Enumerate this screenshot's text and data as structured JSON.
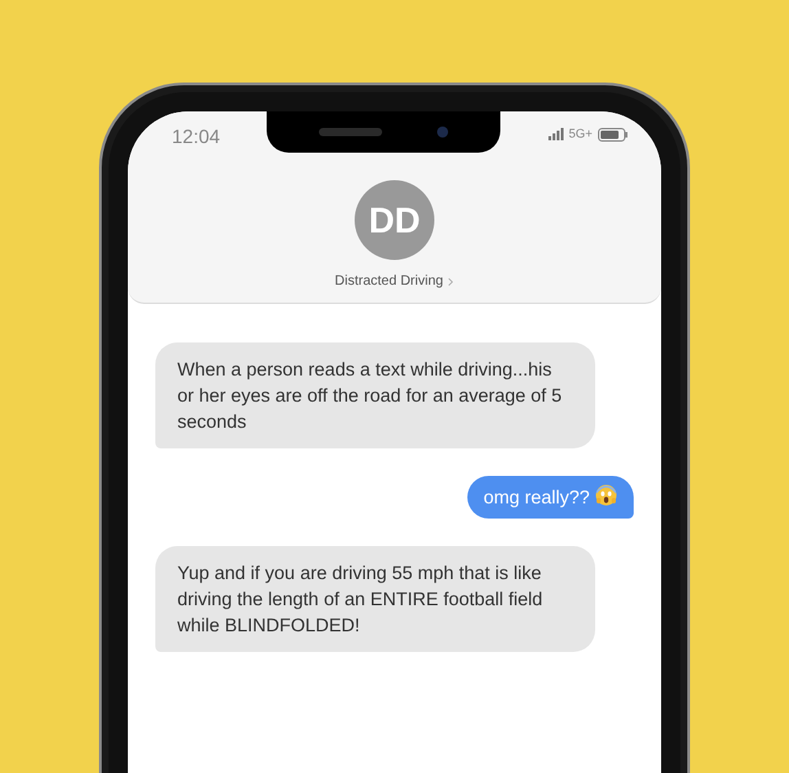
{
  "status_bar": {
    "time": "12:04",
    "network": "5G+"
  },
  "contact": {
    "initials": "DD",
    "name": "Distracted Driving"
  },
  "messages": [
    {
      "kind": "received",
      "text": "When a person reads a text while driving...his or her eyes are off the road for an average of 5 seconds",
      "emoji": false
    },
    {
      "kind": "sent",
      "text": "omg really??",
      "emoji": true
    },
    {
      "kind": "received",
      "text": "Yup and if you are driving 55 mph that is like driving the length of an ENTIRE football field while BLINDFOLDED!",
      "emoji": false
    }
  ]
}
